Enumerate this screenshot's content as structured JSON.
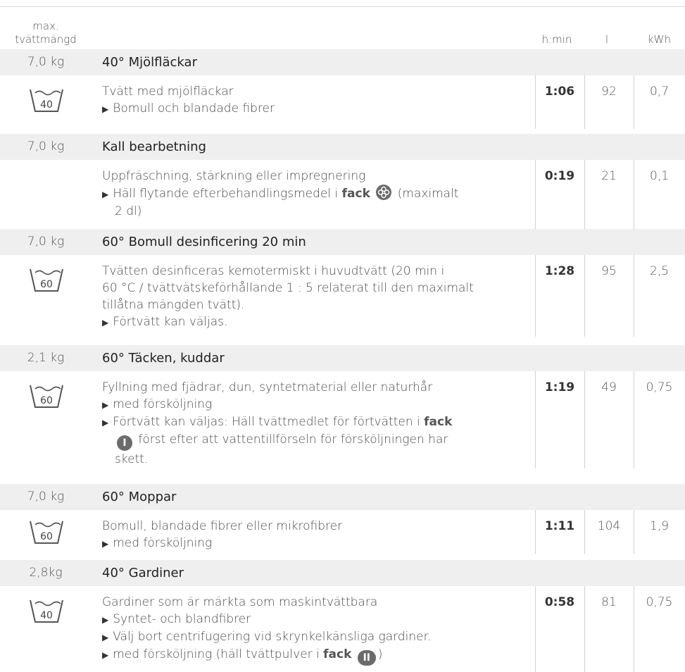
{
  "header": {
    "qty_line1": "max.",
    "qty_line2": "tvättmängd",
    "col_time": "h:min",
    "col_water": "l",
    "col_energy": "kWh"
  },
  "programs": [
    {
      "qty": "7,0 kg",
      "title": "40° Mjölfläckar",
      "icon_temp": "40",
      "lines": [
        "Tvätt med mjölfläckar"
      ],
      "bullets": [
        "Bomull och blandade fibrer"
      ],
      "time": "1:06",
      "water": "92",
      "energy": "0,7"
    },
    {
      "qty": "7,0 kg",
      "title": "Kall bearbetning",
      "icon_temp": "",
      "lines": [
        "Uppfräschning, stärkning eller impregnering"
      ],
      "bullet_a_pre": "Häll flytande efterbehandlingsmedel i ",
      "bullet_a_bold": "fack",
      "bullet_a_post": " (maximalt",
      "bullet_a_post2": "2 dl)",
      "time": "0:19",
      "water": "21",
      "energy": "0,1"
    },
    {
      "qty": "7,0 kg",
      "title": "60° Bomull desinficering 20 min",
      "icon_temp": "60",
      "lines": [
        "Tvätten desinficeras kemotermiskt i huvudtvätt (20 min i",
        "60 °C / tvättvätskeförhållande 1 : 5 relaterat till den maximalt",
        "tillåtna mängden tvätt)."
      ],
      "bullets": [
        "Förtvätt kan väljas."
      ],
      "time": "1:28",
      "water": "95",
      "energy": "2,5"
    },
    {
      "qty": "2,1 kg",
      "title": "60° Täcken, kuddar",
      "icon_temp": "60",
      "lines": [
        "Fyllning med fjädrar, dun, syntetmaterial eller naturhår"
      ],
      "bullet1": "med försköljning",
      "bullet2_pre": "Förtvätt kan väljas: Häll tvättmedlet för förtvätten i ",
      "bullet2_bold": "fack",
      "bullet2_badge": "I",
      "bullet2_post": " först efter att vattentillförseln för försköljningen har",
      "bullet2_post2": "skett.",
      "time": "1:19",
      "water": "49",
      "energy": "0,75"
    },
    {
      "qty": "7,0 kg",
      "title": "60° Moppar",
      "icon_temp": "60",
      "lines": [
        "Bomull, blandade fibrer eller mikrofibrer"
      ],
      "bullets": [
        "med försköljning"
      ],
      "time": "1:11",
      "water": "104",
      "energy": "1,9"
    },
    {
      "qty": "2,8kg",
      "title": "40° Gardiner",
      "icon_temp": "40",
      "lines": [
        "Gardiner som är märkta som maskintvättbara"
      ],
      "bullets": [
        "Syntet- och blandfibrer",
        "Välj bort centrifugering vid skrynkelkänsliga gardiner."
      ],
      "bullet_last_pre": "med försköljning (häll tvättpulver i ",
      "bullet_last_bold": "fack",
      "bullet_last_badge": "II",
      "bullet_last_post": ")",
      "time": "0:58",
      "water": "81",
      "energy": "0,75"
    }
  ],
  "icons": {
    "tub": "wash-tub-icon",
    "flower": "softener-flower-icon",
    "badge_one": "compartment-one-icon",
    "badge_two": "compartment-two-icon"
  }
}
